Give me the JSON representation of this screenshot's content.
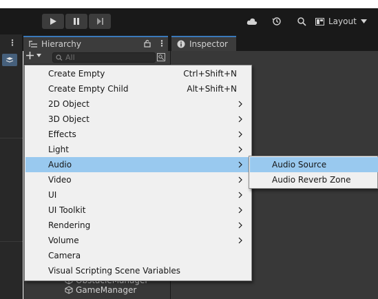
{
  "toolbar": {
    "play_icon": "play-icon",
    "pause_icon": "pause-icon",
    "step_icon": "step-icon",
    "cloud_icon": "cloud-icon",
    "history_icon": "history-icon",
    "search_icon": "search-icon",
    "layout_label": "Layout"
  },
  "tabs": {
    "hierarchy": "Hierarchy",
    "inspector": "Inspector"
  },
  "hierarchy": {
    "search_placeholder": "All",
    "items": [
      "ObstacleManager",
      "GameManager"
    ]
  },
  "menu": {
    "items": [
      {
        "label": "Create Empty",
        "shortcut": "Ctrl+Shift+N",
        "submenu": false
      },
      {
        "label": "Create Empty Child",
        "shortcut": "Alt+Shift+N",
        "submenu": false
      },
      {
        "label": "2D Object",
        "shortcut": "",
        "submenu": true
      },
      {
        "label": "3D Object",
        "shortcut": "",
        "submenu": true
      },
      {
        "label": "Effects",
        "shortcut": "",
        "submenu": true
      },
      {
        "label": "Light",
        "shortcut": "",
        "submenu": true
      },
      {
        "label": "Audio",
        "shortcut": "",
        "submenu": true,
        "highlighted": true
      },
      {
        "label": "Video",
        "shortcut": "",
        "submenu": true
      },
      {
        "label": "UI",
        "shortcut": "",
        "submenu": true
      },
      {
        "label": "UI Toolkit",
        "shortcut": "",
        "submenu": true
      },
      {
        "label": "Rendering",
        "shortcut": "",
        "submenu": true
      },
      {
        "label": "Volume",
        "shortcut": "",
        "submenu": true
      },
      {
        "label": "Camera",
        "shortcut": "",
        "submenu": false
      },
      {
        "label": "Visual Scripting Scene Variables",
        "shortcut": "",
        "submenu": false
      }
    ]
  },
  "submenu": {
    "items": [
      {
        "label": "Audio Source",
        "highlighted": true
      },
      {
        "label": "Audio Reverb Zone",
        "highlighted": false
      }
    ]
  },
  "colors": {
    "highlight": "#99c9ef",
    "menu_bg": "#f0f0f0",
    "panel_bg": "#383838",
    "tab_accent": "#3a79bb"
  }
}
